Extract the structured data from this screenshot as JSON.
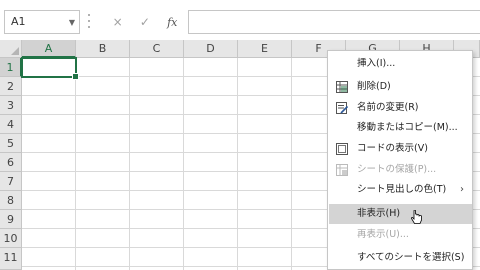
{
  "formula_bar": {
    "name_box": "A1",
    "cancel_symbol": "×",
    "enter_symbol": "✓",
    "fx_symbol": "fx",
    "formula_value": ""
  },
  "grid": {
    "columns": [
      "A",
      "B",
      "C",
      "D",
      "E",
      "F",
      "G",
      "H"
    ],
    "rows": [
      "1",
      "2",
      "3",
      "4",
      "5",
      "6",
      "7",
      "8",
      "9",
      "10",
      "11"
    ],
    "active_cell": "A1"
  },
  "context_menu": {
    "items": [
      {
        "label": "挿入(I)...",
        "enabled": true,
        "icon": "none"
      },
      {
        "label": "削除(D)",
        "enabled": true,
        "icon": "delete-sheet-icon"
      },
      {
        "label": "名前の変更(R)",
        "enabled": true,
        "icon": "rename-sheet-icon"
      },
      {
        "label": "移動またはコピー(M)...",
        "enabled": true,
        "icon": "none"
      },
      {
        "label": "コードの表示(V)",
        "enabled": true,
        "icon": "view-code-icon"
      },
      {
        "label": "シートの保護(P)...",
        "enabled": false,
        "icon": "protect-sheet-icon"
      },
      {
        "label": "シート見出しの色(T)",
        "enabled": true,
        "icon": "none",
        "submenu": true
      },
      {
        "label": "非表示(H)",
        "enabled": true,
        "icon": "none",
        "hover": true
      },
      {
        "label": "再表示(U)...",
        "enabled": false,
        "icon": "none"
      },
      {
        "label": "すべてのシートを選択(S)",
        "enabled": true,
        "icon": "none"
      }
    ],
    "submenu_arrow": "›"
  },
  "colors": {
    "accent": "#217346",
    "header_bg": "#e6e6e6",
    "gridline": "#d9d9d9",
    "menu_hover": "#d4d4d4",
    "disabled_text": "#a6a6a6"
  }
}
